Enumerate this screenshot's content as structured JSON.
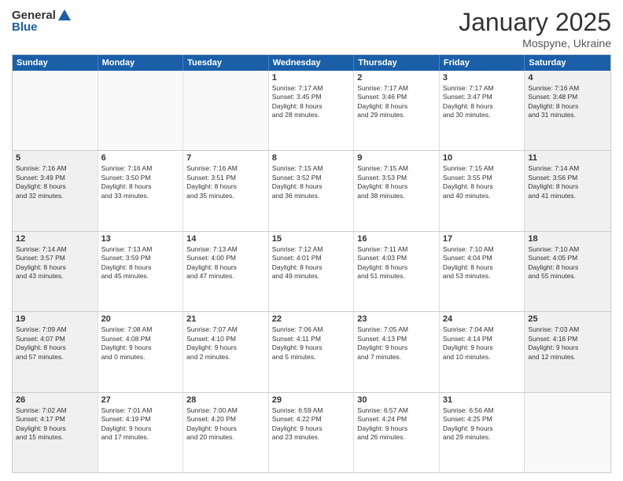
{
  "header": {
    "logo_general": "General",
    "logo_blue": "Blue",
    "month": "January 2025",
    "location": "Mospyne, Ukraine"
  },
  "weekdays": [
    "Sunday",
    "Monday",
    "Tuesday",
    "Wednesday",
    "Thursday",
    "Friday",
    "Saturday"
  ],
  "rows": [
    [
      {
        "day": "",
        "text": "",
        "empty": true
      },
      {
        "day": "",
        "text": "",
        "empty": true
      },
      {
        "day": "",
        "text": "",
        "empty": true
      },
      {
        "day": "1",
        "text": "Sunrise: 7:17 AM\nSunset: 3:45 PM\nDaylight: 8 hours\nand 28 minutes."
      },
      {
        "day": "2",
        "text": "Sunrise: 7:17 AM\nSunset: 3:46 PM\nDaylight: 8 hours\nand 29 minutes."
      },
      {
        "day": "3",
        "text": "Sunrise: 7:17 AM\nSunset: 3:47 PM\nDaylight: 8 hours\nand 30 minutes."
      },
      {
        "day": "4",
        "text": "Sunrise: 7:16 AM\nSunset: 3:48 PM\nDaylight: 8 hours\nand 31 minutes.",
        "shaded": true
      }
    ],
    [
      {
        "day": "5",
        "text": "Sunrise: 7:16 AM\nSunset: 3:49 PM\nDaylight: 8 hours\nand 32 minutes.",
        "shaded": true
      },
      {
        "day": "6",
        "text": "Sunrise: 7:16 AM\nSunset: 3:50 PM\nDaylight: 8 hours\nand 33 minutes."
      },
      {
        "day": "7",
        "text": "Sunrise: 7:16 AM\nSunset: 3:51 PM\nDaylight: 8 hours\nand 35 minutes."
      },
      {
        "day": "8",
        "text": "Sunrise: 7:15 AM\nSunset: 3:52 PM\nDaylight: 8 hours\nand 36 minutes."
      },
      {
        "day": "9",
        "text": "Sunrise: 7:15 AM\nSunset: 3:53 PM\nDaylight: 8 hours\nand 38 minutes."
      },
      {
        "day": "10",
        "text": "Sunrise: 7:15 AM\nSunset: 3:55 PM\nDaylight: 8 hours\nand 40 minutes."
      },
      {
        "day": "11",
        "text": "Sunrise: 7:14 AM\nSunset: 3:56 PM\nDaylight: 8 hours\nand 41 minutes.",
        "shaded": true
      }
    ],
    [
      {
        "day": "12",
        "text": "Sunrise: 7:14 AM\nSunset: 3:57 PM\nDaylight: 8 hours\nand 43 minutes.",
        "shaded": true
      },
      {
        "day": "13",
        "text": "Sunrise: 7:13 AM\nSunset: 3:59 PM\nDaylight: 8 hours\nand 45 minutes."
      },
      {
        "day": "14",
        "text": "Sunrise: 7:13 AM\nSunset: 4:00 PM\nDaylight: 8 hours\nand 47 minutes."
      },
      {
        "day": "15",
        "text": "Sunrise: 7:12 AM\nSunset: 4:01 PM\nDaylight: 8 hours\nand 49 minutes."
      },
      {
        "day": "16",
        "text": "Sunrise: 7:11 AM\nSunset: 4:03 PM\nDaylight: 8 hours\nand 51 minutes."
      },
      {
        "day": "17",
        "text": "Sunrise: 7:10 AM\nSunset: 4:04 PM\nDaylight: 8 hours\nand 53 minutes."
      },
      {
        "day": "18",
        "text": "Sunrise: 7:10 AM\nSunset: 4:05 PM\nDaylight: 8 hours\nand 55 minutes.",
        "shaded": true
      }
    ],
    [
      {
        "day": "19",
        "text": "Sunrise: 7:09 AM\nSunset: 4:07 PM\nDaylight: 8 hours\nand 57 minutes.",
        "shaded": true
      },
      {
        "day": "20",
        "text": "Sunrise: 7:08 AM\nSunset: 4:08 PM\nDaylight: 9 hours\nand 0 minutes."
      },
      {
        "day": "21",
        "text": "Sunrise: 7:07 AM\nSunset: 4:10 PM\nDaylight: 9 hours\nand 2 minutes."
      },
      {
        "day": "22",
        "text": "Sunrise: 7:06 AM\nSunset: 4:11 PM\nDaylight: 9 hours\nand 5 minutes."
      },
      {
        "day": "23",
        "text": "Sunrise: 7:05 AM\nSunset: 4:13 PM\nDaylight: 9 hours\nand 7 minutes."
      },
      {
        "day": "24",
        "text": "Sunrise: 7:04 AM\nSunset: 4:14 PM\nDaylight: 9 hours\nand 10 minutes."
      },
      {
        "day": "25",
        "text": "Sunrise: 7:03 AM\nSunset: 4:16 PM\nDaylight: 9 hours\nand 12 minutes.",
        "shaded": true
      }
    ],
    [
      {
        "day": "26",
        "text": "Sunrise: 7:02 AM\nSunset: 4:17 PM\nDaylight: 9 hours\nand 15 minutes.",
        "shaded": true
      },
      {
        "day": "27",
        "text": "Sunrise: 7:01 AM\nSunset: 4:19 PM\nDaylight: 9 hours\nand 17 minutes."
      },
      {
        "day": "28",
        "text": "Sunrise: 7:00 AM\nSunset: 4:20 PM\nDaylight: 9 hours\nand 20 minutes."
      },
      {
        "day": "29",
        "text": "Sunrise: 6:59 AM\nSunset: 4:22 PM\nDaylight: 9 hours\nand 23 minutes."
      },
      {
        "day": "30",
        "text": "Sunrise: 6:57 AM\nSunset: 4:24 PM\nDaylight: 9 hours\nand 26 minutes."
      },
      {
        "day": "31",
        "text": "Sunrise: 6:56 AM\nSunset: 4:25 PM\nDaylight: 9 hours\nand 29 minutes."
      },
      {
        "day": "",
        "text": "",
        "empty": true,
        "shaded": true
      }
    ]
  ]
}
